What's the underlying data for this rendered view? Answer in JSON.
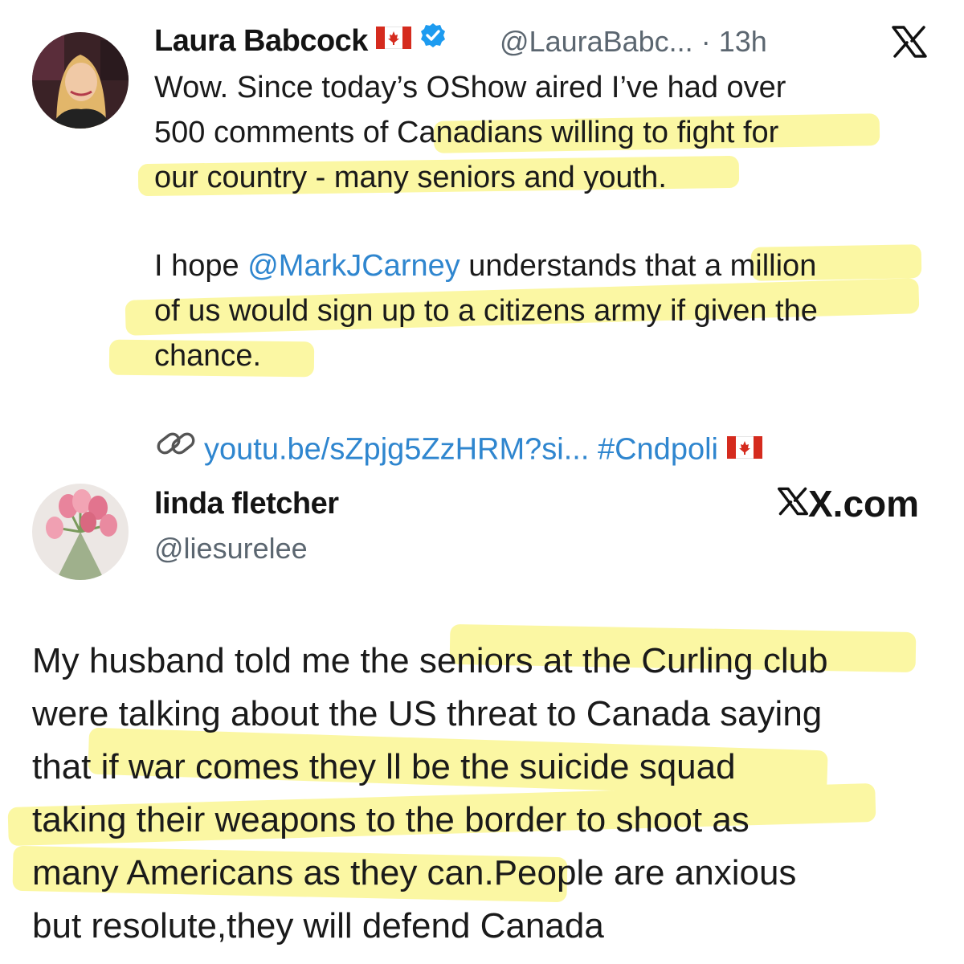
{
  "tweet1": {
    "author_name": "Laura Babcock",
    "handle": "@LauraBabc...",
    "separator": "·",
    "time": "13h",
    "flag_icon": "canada-flag-icon",
    "verified_icon": "verified-badge-icon",
    "platform_icon": "x-logo-icon",
    "lines": [
      "Wow. Since today’s OShow aired I’ve had over",
      "500 comments of Canadians willing to fight for",
      "our country - many seniors and youth."
    ],
    "para2_prefix": "I hope ",
    "mention": "@MarkJCarney",
    "para2_line1_rest": " understands that a million",
    "para2_lines": [
      "of us would sign up to a citizens army if given the",
      "chance."
    ],
    "link_url": "youtu.be/sZpjg5ZzHRM?si...",
    "hashtag": "#Cndpoli",
    "link_icon": "link-chain-icon",
    "highlight_color": "#fbf7a3",
    "link_color": "#2f86cf"
  },
  "tweet2": {
    "author_name": "linda fletcher",
    "handle": "@liesurelee",
    "platform_label": "X.com",
    "lines": [
      "My husband told me the seniors at the Curling club",
      "were talking about the US threat to Canada saying",
      "that if war comes they ll be the suicide squad",
      "taking their weapons to the border to shoot as",
      "many Americans as they can.People are anxious",
      "but resolute,they will defend Canada"
    ]
  }
}
